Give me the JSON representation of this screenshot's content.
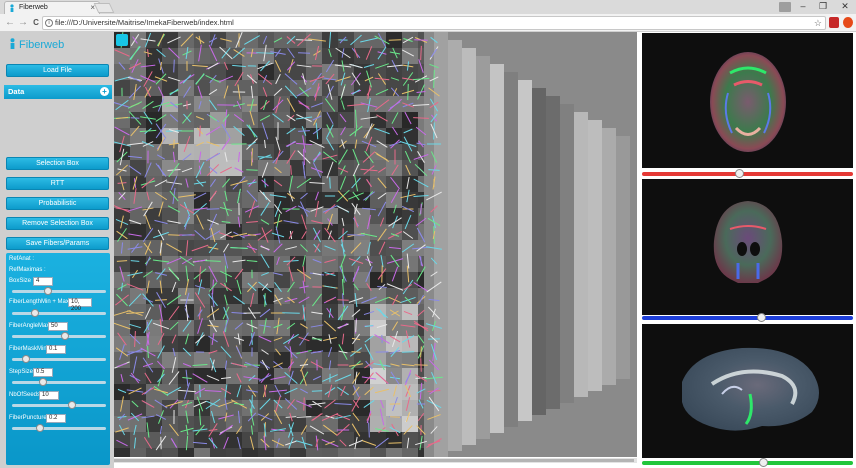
{
  "browser": {
    "tab_title": "Fiberweb",
    "tab_close": "×",
    "url": "file:///D:/Universite/Maitrise/ImekaFiberweb/index.html",
    "window_minimize": "–",
    "window_restore": "❐",
    "window_close": "✕",
    "back": "←",
    "forward": "→",
    "reload": "C",
    "info": "i",
    "star": "☆"
  },
  "app": {
    "title": "Fiberweb",
    "accent": "#1aa9d6",
    "load_file_label": "Load File",
    "data_section_label": "Data",
    "data_toggle": "+",
    "buttons": {
      "selection_box": "Selection Box",
      "rtt": "RTT",
      "probabilistic": "Probabilistic",
      "remove_selection_box": "Remove Selection Box",
      "save_fibers_params": "Save Fibers/Params"
    },
    "params": {
      "ref_anat": "RefAnat :",
      "ref_maximas": "RefMaximas :",
      "box_size_label": "BoxSize :",
      "box_size_value": "4",
      "box_size_level": 0.38,
      "fiber_length_label": "FiberLengthMin + Max :",
      "fiber_length_value": "10, 200",
      "fiber_length_level": 0.22,
      "fiber_angle_label": "FiberAngleMax :",
      "fiber_angle_value": "50",
      "fiber_angle_level": 0.58,
      "fiber_mask_label": "FiberMaskMin :",
      "fiber_mask_value": "0.1",
      "fiber_mask_level": 0.12,
      "step_size_label": "StepSize :",
      "step_size_value": "0.5",
      "step_size_level": 0.32,
      "nb_seeds_label": "NbOfSeeds :",
      "nb_seeds_value": "10",
      "nb_seeds_level": 0.66,
      "fiber_puncture_label": "FiberPuncture :",
      "fiber_puncture_value": "0.2",
      "fiber_puncture_level": 0.28
    },
    "views": {
      "axial_slider_color": "#e53935",
      "axial_level": 0.46,
      "coronal_slider_color": "#1e3fd9",
      "coronal_level": 0.57,
      "sagittal_slider_color": "#21c63b",
      "sagittal_level": 0.58
    }
  }
}
